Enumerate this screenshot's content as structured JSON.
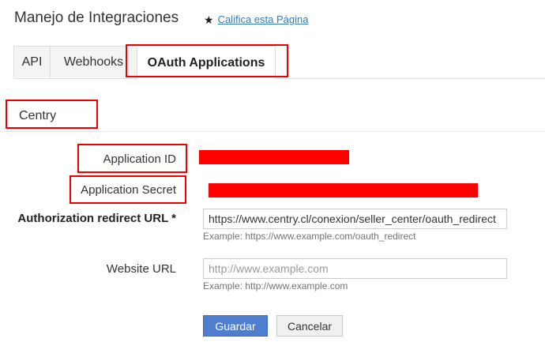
{
  "page": {
    "title": "Manejo de Integraciones",
    "rate_link": "Califica esta Página"
  },
  "tabs": [
    {
      "label": "API"
    },
    {
      "label": "Webhooks"
    },
    {
      "label": "OAuth Applications",
      "active": true
    }
  ],
  "app": {
    "name": "Centry"
  },
  "form": {
    "application_id": {
      "label": "Application ID"
    },
    "application_secret": {
      "label": "Application Secret"
    },
    "redirect_url": {
      "label": "Authorization redirect URL *",
      "value": "https://www.centry.cl/conexion/seller_center/oauth_redirect",
      "help": "Example: https://www.example.com/oauth_redirect"
    },
    "website_url": {
      "label": "Website URL",
      "value": "",
      "placeholder": "http://www.example.com",
      "help": "Example: http://www.example.com"
    }
  },
  "actions": {
    "save": "Guardar",
    "cancel": "Cancelar"
  },
  "colors": {
    "highlight": "#ee0000",
    "redaction": "#ff0000",
    "primary": "#4f7ecf",
    "link": "#337ab7"
  },
  "icons": {
    "rate": "star-icon"
  }
}
